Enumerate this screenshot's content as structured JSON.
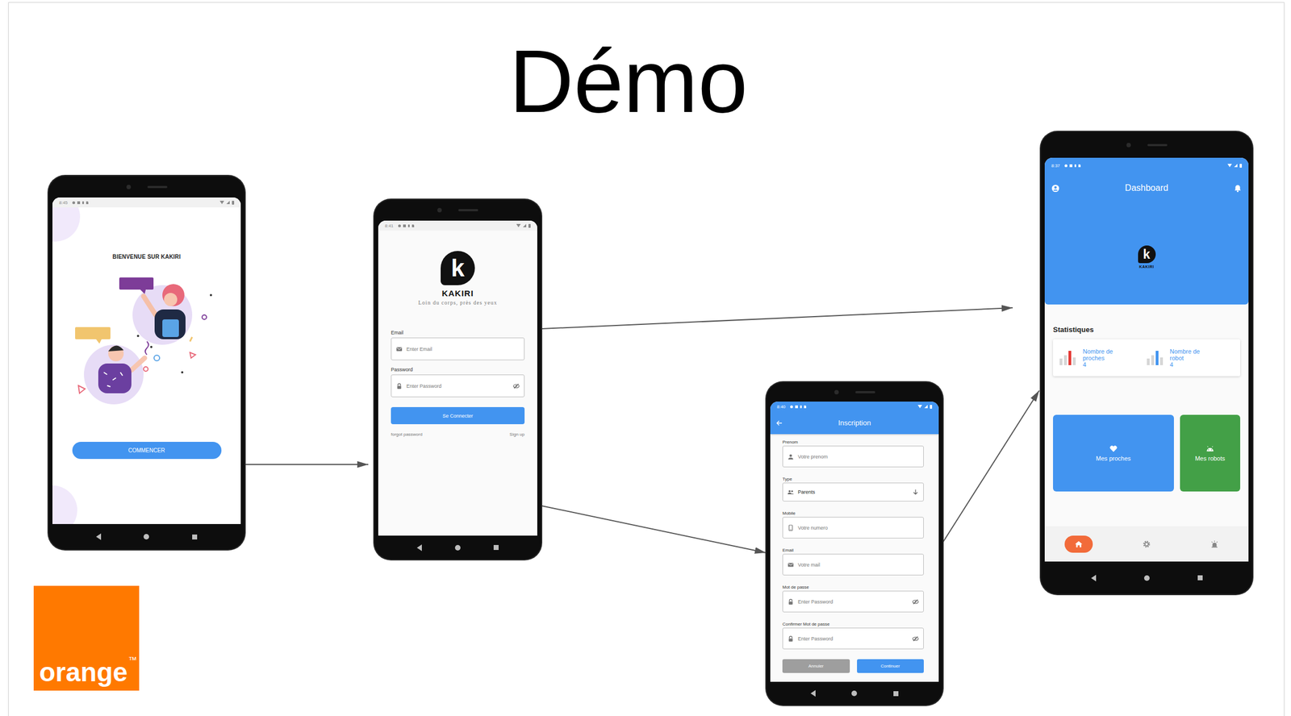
{
  "slide": {
    "title": "Démo"
  },
  "brand_logo": {
    "text": "orange",
    "mark": "™"
  },
  "screens": [
    {
      "kind": "welcome",
      "status": {
        "time": "8:45"
      },
      "heading": "BIENVENUE SUR KAKIRI",
      "button": "COMMENCER"
    },
    {
      "kind": "login",
      "status": {
        "time": "8:41"
      },
      "logo": {
        "letter": "k",
        "name": "KAKIRI",
        "tagline": "Loin du corps, près des yeux"
      },
      "fields": [
        {
          "label": "Email",
          "placeholder": "Enter Email",
          "kind": "email"
        },
        {
          "label": "Password",
          "placeholder": "Enter Password",
          "kind": "password"
        }
      ],
      "submit": "Se Connecter",
      "links": [
        "forgot password",
        "Sign up"
      ]
    },
    {
      "kind": "signup",
      "status": {
        "time": "8:40"
      },
      "app_bar": {
        "title": "Inscription"
      },
      "fields": [
        {
          "label": "Prenom",
          "placeholder": "Votre prenom",
          "kind": "person"
        },
        {
          "label": "Type",
          "value": "Parents",
          "kind": "select"
        },
        {
          "label": "Mobile",
          "placeholder": "Votre numero",
          "kind": "phone"
        },
        {
          "label": "Email",
          "placeholder": "Votre mail",
          "kind": "email"
        },
        {
          "label": "Mot de passe",
          "placeholder": "Enter Password",
          "kind": "password"
        },
        {
          "label": "Confirmer Mot de passe",
          "placeholder": "Enter Password",
          "kind": "password"
        }
      ],
      "buttons": [
        {
          "label": "Annuler",
          "primary": false
        },
        {
          "label": "Continuer",
          "primary": true
        }
      ]
    },
    {
      "kind": "dashboard",
      "status": {
        "time": "8:37"
      },
      "app_bar": {
        "title": "Dashboard"
      },
      "logo": {
        "letter": "k",
        "name": "KAKIRI"
      },
      "section": "Statistiques",
      "stats": [
        {
          "label": "Nombre de proches",
          "value": "4",
          "color": "#e53935"
        },
        {
          "label": "Nombre de robot",
          "value": "4",
          "color": "#4294f0"
        }
      ],
      "tiles": [
        {
          "label": "Mes proches",
          "kind": "heart",
          "color": "#4294f0"
        },
        {
          "label": "Mes robots",
          "kind": "robot",
          "color": "#43a047"
        }
      ],
      "nav": [
        {
          "kind": "home",
          "selected": true
        },
        {
          "kind": "settings",
          "selected": false
        },
        {
          "kind": "alarm",
          "selected": false
        }
      ]
    }
  ],
  "flows": [
    {
      "from": 0,
      "to": 1
    },
    {
      "from": 1,
      "to": 3
    },
    {
      "from": 1,
      "to": 2
    },
    {
      "from": 2,
      "to": 3
    }
  ]
}
